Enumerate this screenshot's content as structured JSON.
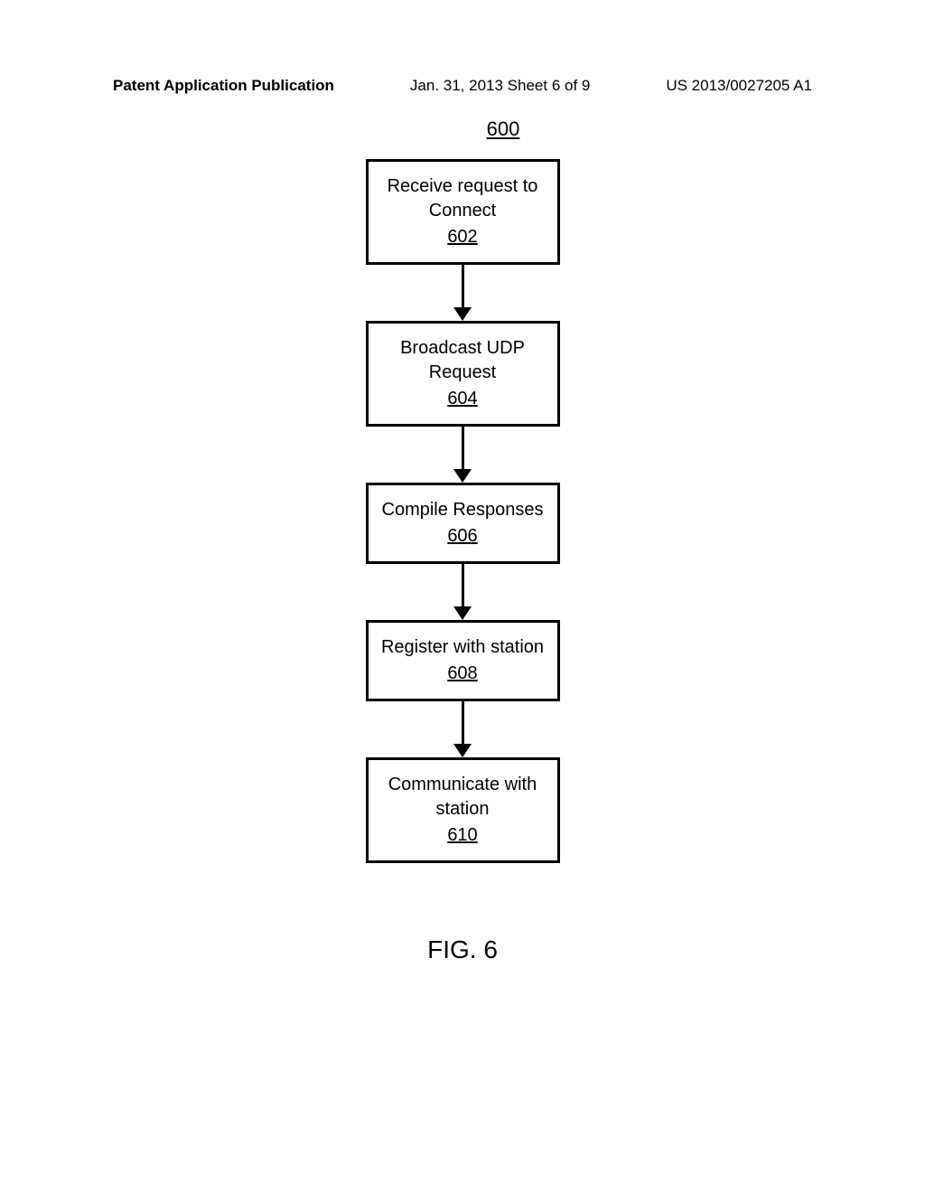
{
  "header": {
    "left": "Patent Application Publication",
    "center": "Jan. 31, 2013  Sheet 6 of 9",
    "right": "US 2013/0027205 A1"
  },
  "figure": {
    "number": "600",
    "caption": "FIG. 6",
    "blocks": [
      {
        "text": "Receive request to Connect",
        "num": "602"
      },
      {
        "text": "Broadcast UDP Request",
        "num": "604"
      },
      {
        "text": "Compile Responses",
        "num": "606"
      },
      {
        "text": "Register with station",
        "num": "608"
      },
      {
        "text": "Communicate with station",
        "num": "610"
      }
    ]
  }
}
